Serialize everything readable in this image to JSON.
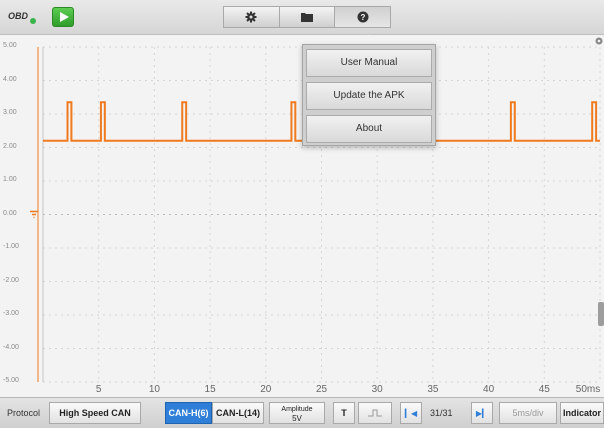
{
  "topbar": {
    "obd_label": "OBD",
    "icons": [
      "play-icon",
      "gear-icon",
      "folder-icon",
      "help-icon"
    ]
  },
  "menu": {
    "items": [
      "User Manual",
      "Update the APK",
      "About"
    ]
  },
  "plot": {
    "y_ticks": [
      "5.00",
      "4.00",
      "3.00",
      "2.00",
      "1.00",
      "0.00",
      "-1.00",
      "-2.00",
      "-3.00",
      "-4.00",
      "-5.00"
    ],
    "x_ticks": [
      "5",
      "10",
      "15",
      "20",
      "25",
      "30",
      "35",
      "40",
      "45",
      "50ms"
    ],
    "trace_color": "#f07a1e",
    "baseline_v": 2.2,
    "pulse_peak_v": 3.35,
    "pulse_times_ms": [
      2.2,
      5.2,
      12.5,
      22.3,
      32.1,
      34.8,
      42.0,
      49.3
    ]
  },
  "bottombar": {
    "protocol_label": "Protocol",
    "protocol_value": "High Speed CAN",
    "channel_1": "CAN-H(6)",
    "channel_2": "CAN-L(14)",
    "amplitude_label": "Amplitude",
    "amplitude_value": "5V",
    "trigger_label": "T",
    "page_counter": "31/31",
    "timebase": "5ms/div",
    "indicator_label": "Indicator"
  },
  "colors": {
    "accent": "#2f7ed8",
    "trace": "#f07a1e",
    "play": "#3bb54a"
  }
}
